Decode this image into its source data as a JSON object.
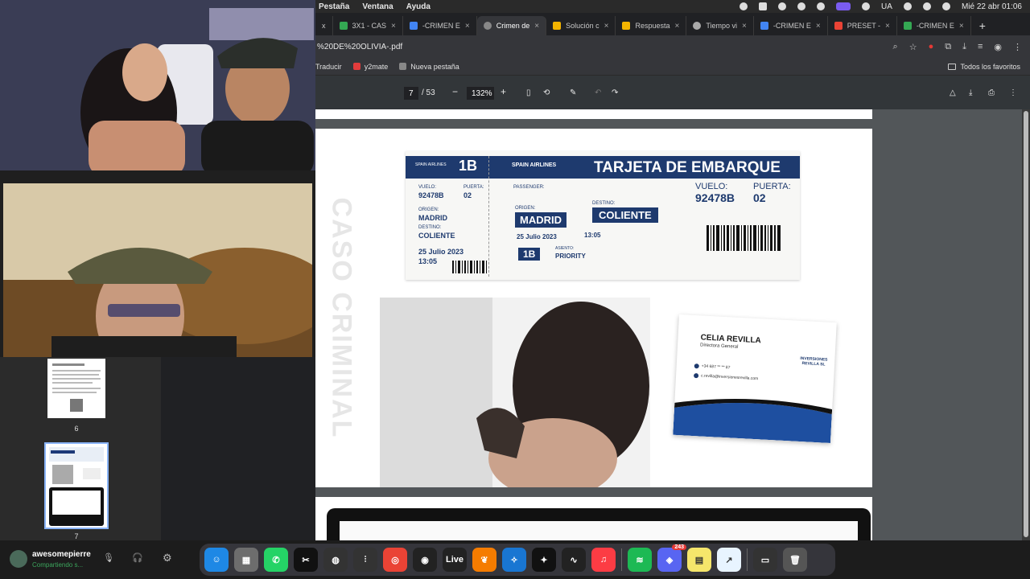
{
  "menubar": {
    "items": [
      "Pestaña",
      "Ventana",
      "Ayuda"
    ],
    "region": "UA",
    "datetime": "Mié 22 abr  01:06"
  },
  "tabs": [
    {
      "label": "x",
      "color": "#cccccc"
    },
    {
      "label": "3X1 - CAS",
      "color": "#34a853"
    },
    {
      "label": "-CRIMEN E",
      "color": "#4285f4"
    },
    {
      "label": "Crimen de",
      "color": "#888888",
      "active": true
    },
    {
      "label": "Solución c",
      "color": "#f4b400"
    },
    {
      "label": "Respuesta",
      "color": "#f4b400"
    },
    {
      "label": "Tiempo vi",
      "color": "#aaaaaa"
    },
    {
      "label": "-CRIMEN E",
      "color": "#4285f4"
    },
    {
      "label": "PRESET -",
      "color": "#ea4335"
    },
    {
      "label": "-CRIMEN E",
      "color": "#34a853"
    }
  ],
  "address": {
    "url": "%20DE%20OLIVIA-.pdf"
  },
  "bookmarks": {
    "items": [
      "Traducir",
      "y2mate",
      "Nueva pestaña"
    ],
    "favorites": "Todos los favoritos"
  },
  "pdf": {
    "page_current": "7",
    "page_total": "/ 53",
    "zoom": "132%"
  },
  "boarding_pass": {
    "airline_short": "SPAIN AIRLINES",
    "seat_big": "1B",
    "title": "TARJETA DE EMBARQUE",
    "passenger_label": "PASSENGER:",
    "vuelo_label": "VUELO:",
    "vuelo": "92478B",
    "puerta_label": "PUERTA:",
    "puerta": "02",
    "origen_label": "ORIGEN:",
    "origen": "MADRID",
    "destino_label": "DESTINO:",
    "destino": "COLIENTE",
    "date": "25 Julio 2023",
    "time": "13:05",
    "asiento_label": "ASIENTO:",
    "asiento_class": "PRIORITY",
    "watermark": "CASO CRIMINAL"
  },
  "business_card": {
    "name": "CELIA REVILLA",
    "role": "Directora General",
    "phone": "+34 687 ** ** 87",
    "email": "c.revilla@inversionesrevilla.com",
    "company": "INVERSIONES REVILLA SL"
  },
  "thumbnails": [
    {
      "label": "6"
    },
    {
      "label": "7"
    }
  ],
  "user": {
    "name": "awesomepierre",
    "status": "Compartiendo s..."
  },
  "dock": {
    "live_label": "Live",
    "discord_badge": "243"
  }
}
